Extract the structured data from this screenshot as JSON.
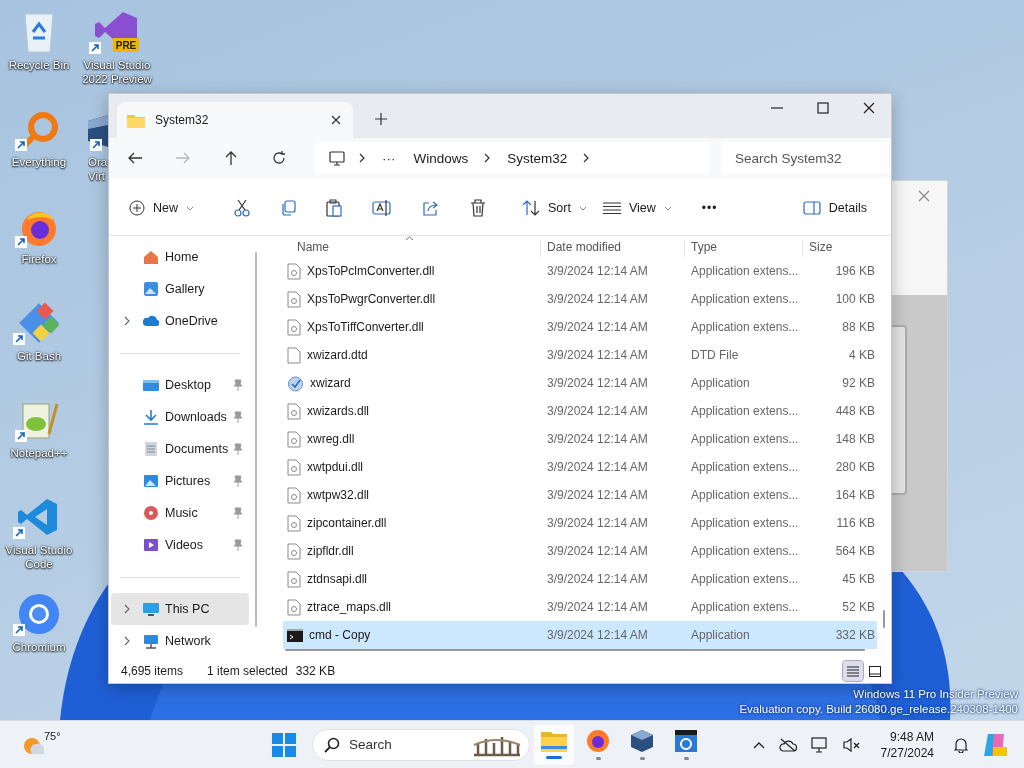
{
  "desktop_icons": [
    {
      "label": "Recycle Bin",
      "kind": "recycle",
      "shortcut": false
    },
    {
      "label": "Everything",
      "kind": "everything",
      "shortcut": true
    },
    {
      "label": "Firefox",
      "kind": "firefox",
      "shortcut": true
    },
    {
      "label": "Git Bash",
      "kind": "gitbash",
      "shortcut": true
    },
    {
      "label": "Notepad++",
      "kind": "notepad",
      "shortcut": true
    },
    {
      "label": "Visual Studio Code",
      "kind": "vscode",
      "shortcut": true
    },
    {
      "label": "Chromium",
      "kind": "chromium",
      "shortcut": true
    },
    {
      "label": "Visual Studio 2022 Preview",
      "kind": "vs",
      "shortcut": true,
      "badge": "PRE"
    },
    {
      "label": "Ora\nVirt",
      "kind": "virtualbox",
      "shortcut": true
    }
  ],
  "explorer": {
    "tab": {
      "title": "System32"
    },
    "address": {
      "overflow": "···",
      "crumbs": [
        "Windows",
        "System32"
      ]
    },
    "nav": [
      {
        "kind": "back",
        "disabled": false
      },
      {
        "kind": "forward",
        "disabled": true
      },
      {
        "kind": "up",
        "disabled": false
      },
      {
        "kind": "refresh",
        "disabled": false
      }
    ],
    "search": {
      "placeholder": "Search System32"
    },
    "toolbar": [
      {
        "kind": "new",
        "label": "New",
        "dropdown": true
      },
      {
        "kind": "cut"
      },
      {
        "kind": "copy"
      },
      {
        "kind": "paste"
      },
      {
        "kind": "rename"
      },
      {
        "kind": "share"
      },
      {
        "kind": "delete"
      },
      {
        "kind": "sort",
        "label": "Sort",
        "dropdown": true
      },
      {
        "kind": "view",
        "label": "View",
        "dropdown": true
      },
      {
        "kind": "more",
        "label": "•••"
      },
      {
        "kind": "details",
        "label": "Details"
      }
    ],
    "sidebar": [
      {
        "label": "Home",
        "kind": "home",
        "expandable": false,
        "pinned": false,
        "selected": false
      },
      {
        "label": "Gallery",
        "kind": "gallery",
        "expandable": false,
        "pinned": false,
        "selected": false
      },
      {
        "label": "OneDrive",
        "kind": "cloud",
        "expandable": true,
        "pinned": false,
        "selected": false
      },
      {
        "kind": "divider"
      },
      {
        "label": "Desktop",
        "kind": "desktop",
        "expandable": false,
        "pinned": true,
        "selected": false
      },
      {
        "label": "Downloads",
        "kind": "download",
        "expandable": false,
        "pinned": true,
        "selected": false
      },
      {
        "label": "Documents",
        "kind": "documents",
        "expandable": false,
        "pinned": true,
        "selected": false
      },
      {
        "label": "Pictures",
        "kind": "pictures",
        "expandable": false,
        "pinned": true,
        "selected": false
      },
      {
        "label": "Music",
        "kind": "music",
        "expandable": false,
        "pinned": true,
        "selected": false
      },
      {
        "label": "Videos",
        "kind": "videos",
        "expandable": false,
        "pinned": true,
        "selected": false
      },
      {
        "kind": "divider"
      },
      {
        "label": "This PC",
        "kind": "pc",
        "expandable": true,
        "pinned": false,
        "selected": true
      },
      {
        "label": "Network",
        "kind": "network",
        "expandable": true,
        "pinned": false,
        "selected": false
      }
    ],
    "table": {
      "columns": [
        "Name",
        "Date modified",
        "Type",
        "Size"
      ],
      "rows": [
        {
          "name": "XpsToPclmConverter.dll",
          "date": "3/9/2024 12:14 AM",
          "type": "Application extens...",
          "size": "196 KB",
          "kind": "dll",
          "selected": false
        },
        {
          "name": "XpsToPwgrConverter.dll",
          "date": "3/9/2024 12:14 AM",
          "type": "Application extens...",
          "size": "100 KB",
          "kind": "dll",
          "selected": false
        },
        {
          "name": "XpsToTiffConverter.dll",
          "date": "3/9/2024 12:14 AM",
          "type": "Application extens...",
          "size": "88 KB",
          "kind": "dll",
          "selected": false
        },
        {
          "name": "xwizard.dtd",
          "date": "3/9/2024 12:14 AM",
          "type": "DTD File",
          "size": "4 KB",
          "kind": "blank",
          "selected": false
        },
        {
          "name": "xwizard",
          "date": "3/9/2024 12:14 AM",
          "type": "Application",
          "size": "92 KB",
          "kind": "app",
          "selected": false
        },
        {
          "name": "xwizards.dll",
          "date": "3/9/2024 12:14 AM",
          "type": "Application extens...",
          "size": "448 KB",
          "kind": "dll",
          "selected": false
        },
        {
          "name": "xwreg.dll",
          "date": "3/9/2024 12:14 AM",
          "type": "Application extens...",
          "size": "148 KB",
          "kind": "dll",
          "selected": false
        },
        {
          "name": "xwtpdui.dll",
          "date": "3/9/2024 12:14 AM",
          "type": "Application extens...",
          "size": "280 KB",
          "kind": "dll",
          "selected": false
        },
        {
          "name": "xwtpw32.dll",
          "date": "3/9/2024 12:14 AM",
          "type": "Application extens...",
          "size": "164 KB",
          "kind": "dll",
          "selected": false
        },
        {
          "name": "zipcontainer.dll",
          "date": "3/9/2024 12:14 AM",
          "type": "Application extens...",
          "size": "116 KB",
          "kind": "dll",
          "selected": false
        },
        {
          "name": "zipfldr.dll",
          "date": "3/9/2024 12:14 AM",
          "type": "Application extens...",
          "size": "564 KB",
          "kind": "dll",
          "selected": false
        },
        {
          "name": "ztdnsapi.dll",
          "date": "3/9/2024 12:14 AM",
          "type": "Application extens...",
          "size": "45 KB",
          "kind": "dll",
          "selected": false
        },
        {
          "name": "ztrace_maps.dll",
          "date": "3/9/2024 12:14 AM",
          "type": "Application extens...",
          "size": "52 KB",
          "kind": "dll",
          "selected": false
        },
        {
          "name": "cmd - Copy",
          "date": "3/9/2024 12:14 AM",
          "type": "Application",
          "size": "332 KB",
          "kind": "console",
          "selected": true
        }
      ]
    },
    "status_bar": {
      "count": "4,695 items",
      "selection": "1 item selected",
      "size": "332 KB"
    },
    "views": [
      {
        "kind": "details",
        "selected": true
      },
      {
        "kind": "tiles",
        "selected": false
      }
    ]
  },
  "watermark": [
    "Windows 11 Pro Insider Preview",
    "Evaluation copy. Build 26080.ge_release.240308-1400"
  ],
  "taskbar": {
    "weather": "75°",
    "search": {
      "placeholder": "Search"
    },
    "apps": [
      {
        "kind": "explorer",
        "active": true
      },
      {
        "kind": "firefox",
        "active": false
      },
      {
        "kind": "virtualbox",
        "active": false
      },
      {
        "kind": "appblue",
        "active": false
      }
    ],
    "time": "9:48 AM",
    "date": "7/27/2024"
  }
}
